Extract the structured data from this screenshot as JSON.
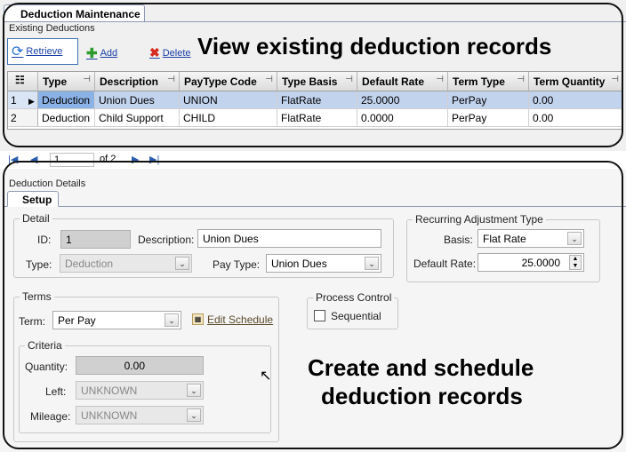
{
  "maintenance": {
    "tab_title": "Deduction Maintenance",
    "section_label": "Existing Deductions",
    "toolbar": {
      "retrieve": "Retrieve",
      "add": "Add",
      "delete": "Delete"
    },
    "grid": {
      "columns": [
        "Type",
        "Description",
        "PayType Code",
        "Type Basis",
        "Default Rate",
        "Term Type",
        "Term Quantity"
      ],
      "rows": [
        {
          "num": "1",
          "cells": [
            "Deduction",
            "Union Dues",
            "UNION",
            "FlatRate",
            "25.0000",
            "PerPay",
            "0.00"
          ]
        },
        {
          "num": "2",
          "cells": [
            "Deduction",
            "Child Support",
            "CHILD",
            "FlatRate",
            "0.0000",
            "PerPay",
            "0.00"
          ]
        }
      ]
    },
    "pager": {
      "page": "1",
      "of_label": "of 2"
    }
  },
  "details": {
    "section_label": "Deduction Details",
    "tab": "Setup",
    "detail": {
      "legend": "Detail",
      "id_label": "ID:",
      "id_value": "1",
      "description_label": "Description:",
      "description_value": "Union Dues",
      "type_label": "Type:",
      "type_value": "Deduction",
      "paytype_label": "Pay Type:",
      "paytype_value": "Union Dues"
    },
    "recurring": {
      "legend": "Recurring Adjustment Type",
      "basis_label": "Basis:",
      "basis_value": "Flat Rate",
      "rate_label": "Default Rate:",
      "rate_value": "25.0000"
    },
    "terms": {
      "legend": "Terms",
      "term_label": "Term:",
      "term_value": "Per Pay",
      "edit_schedule": "Edit Schedule"
    },
    "criteria": {
      "legend": "Criteria",
      "quantity_label": "Quantity:",
      "quantity_value": "0.00",
      "left_label": "Left:",
      "left_value": "UNKNOWN",
      "mileage_label": "Mileage:",
      "mileage_value": "UNKNOWN"
    },
    "process": {
      "legend": "Process Control",
      "sequential_label": "Sequential",
      "sequential_checked": false
    }
  },
  "annotations": {
    "top": "View existing deduction records",
    "bottom_line1": "Create and schedule",
    "bottom_line2": "deduction records"
  }
}
